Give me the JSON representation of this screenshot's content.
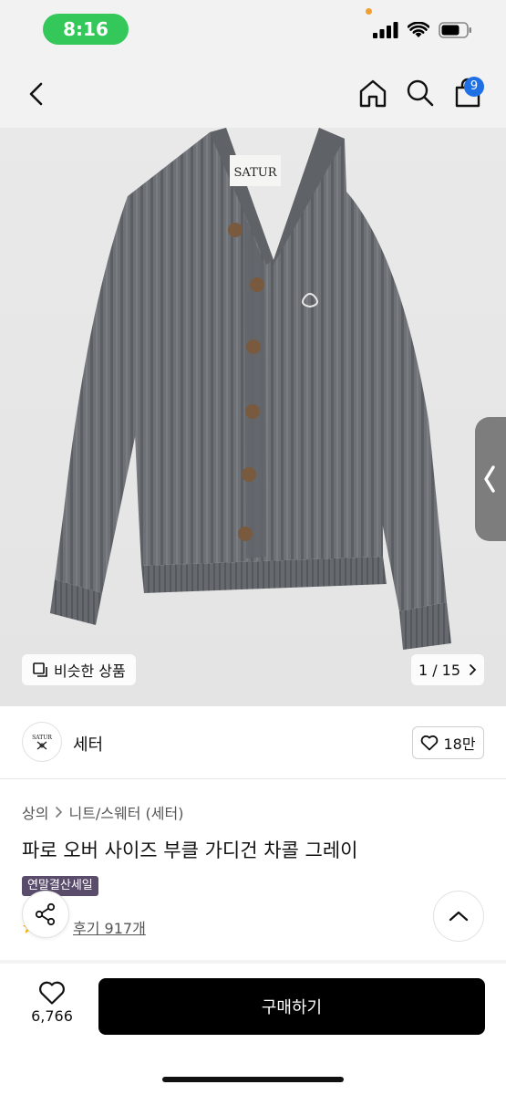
{
  "status_bar": {
    "time": "8:16"
  },
  "nav": {
    "cart_count": "9"
  },
  "product_image": {
    "brand_label": "SATUR",
    "similar_label": "비슷한 상품",
    "page_indicator": "1 / 15",
    "colors": {
      "knit": "#6e7176",
      "rib": "#5b5e63",
      "button": "#7a5a3e"
    }
  },
  "brand": {
    "logo_text": "SATUR",
    "name": "세터",
    "like_count": "18만"
  },
  "product": {
    "breadcrumb": [
      "상의",
      "니트/스웨터 (세터)"
    ],
    "title": "파로 오버 사이즈 부클 가디건 차콜 그레이",
    "sale_badge": "연말결산세일",
    "review_label": "후기 917개"
  },
  "bottom_bar": {
    "wish_count": "6,766",
    "buy_label": "구매하기"
  }
}
